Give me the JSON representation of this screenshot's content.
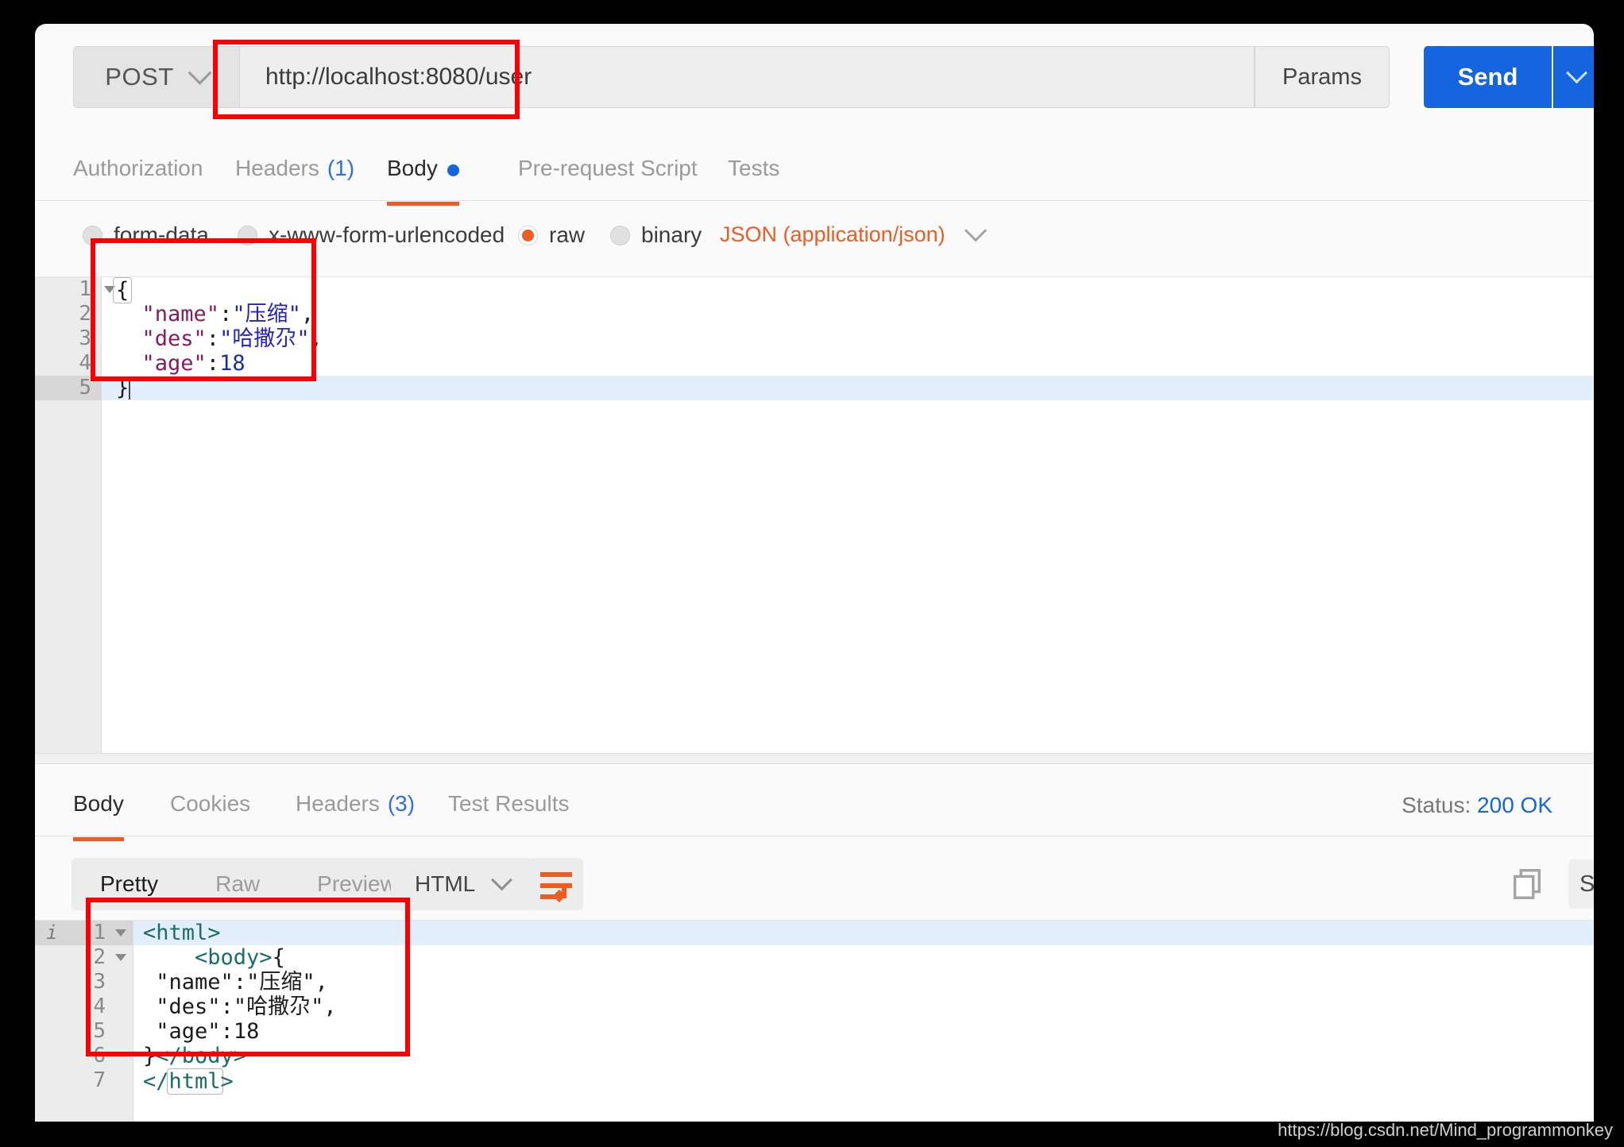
{
  "request": {
    "method": "POST",
    "url": "http://localhost:8080/user",
    "params_label": "Params",
    "send_label": "Send",
    "tabs": [
      {
        "label": "Authorization",
        "count": "",
        "active": false
      },
      {
        "label": "Headers",
        "count": "(1)",
        "active": false
      },
      {
        "label": "Body",
        "count": "",
        "active": true
      },
      {
        "label": "Pre-request Script",
        "count": "",
        "active": false
      },
      {
        "label": "Tests",
        "count": "",
        "active": false
      }
    ],
    "body_types": [
      {
        "label": "form-data",
        "selected": false
      },
      {
        "label": "x-www-form-urlencoded",
        "selected": false
      },
      {
        "label": "raw",
        "selected": true
      },
      {
        "label": "binary",
        "selected": false
      }
    ],
    "content_type": "JSON (application/json)",
    "editor": {
      "lines": [
        {
          "no": "1",
          "fold": true,
          "hl": false
        },
        {
          "no": "2",
          "fold": false,
          "hl": false
        },
        {
          "no": "3",
          "fold": false,
          "hl": false
        },
        {
          "no": "4",
          "fold": false,
          "hl": false
        },
        {
          "no": "5",
          "fold": false,
          "hl": true
        }
      ],
      "code": {
        "l1_brace": "{",
        "l2_key": "\"name\"",
        "l2_colon": ":",
        "l2_val": "\"压缩\"",
        "l2_comma": ",",
        "l3_key": "\"des\"",
        "l3_colon": ":",
        "l3_val": "\"哈撒尕\"",
        "l3_comma": ",",
        "l4_key": "\"age\"",
        "l4_colon": ":",
        "l4_val": "18",
        "l5_brace": "}"
      }
    }
  },
  "response": {
    "tabs": [
      {
        "label": "Body",
        "count": "",
        "active": true
      },
      {
        "label": "Cookies",
        "count": "",
        "active": false
      },
      {
        "label": "Headers",
        "count": "(3)",
        "active": false
      },
      {
        "label": "Test Results",
        "count": "",
        "active": false
      }
    ],
    "status_label": "Status:",
    "status_value": "200 OK",
    "view_modes": [
      {
        "label": "Pretty",
        "active": true
      },
      {
        "label": "Raw",
        "active": false
      },
      {
        "label": "Preview",
        "active": false
      }
    ],
    "format": "HTML",
    "truncated_button": "S",
    "editor": {
      "lines": [
        {
          "no": "1",
          "fold": true,
          "hl": true,
          "info": "i"
        },
        {
          "no": "2",
          "fold": true,
          "hl": false,
          "info": ""
        },
        {
          "no": "3",
          "fold": false,
          "hl": false,
          "info": ""
        },
        {
          "no": "4",
          "fold": false,
          "hl": false,
          "info": ""
        },
        {
          "no": "5",
          "fold": false,
          "hl": false,
          "info": ""
        },
        {
          "no": "6",
          "fold": false,
          "hl": false,
          "info": ""
        },
        {
          "no": "7",
          "fold": false,
          "hl": false,
          "info": ""
        }
      ],
      "code": {
        "l1_tag": "<html>",
        "l2_tag": "<body>",
        "l2_brace": "{",
        "l3_key": "\"name\"",
        "l3_colon": ":",
        "l3_val": "\"压缩\"",
        "l3_comma": ",",
        "l4_key": "\"des\"",
        "l4_colon": ":",
        "l4_val": "\"哈撒尕\"",
        "l4_comma": ",",
        "l5_key": "\"age\"",
        "l5_colon": ":",
        "l5_val": "18",
        "l6_brace": "}",
        "l6_tag": "</body>",
        "l7_tag_open": "</",
        "l7_tag_name": "html",
        "l7_tag_close": ">"
      }
    }
  },
  "watermark": "https://blog.csdn.net/Mind_programmonkey",
  "colors": {
    "accent_orange": "#ef5b25",
    "accent_blue": "#1565e0",
    "annotation_red": "#fb0000"
  }
}
